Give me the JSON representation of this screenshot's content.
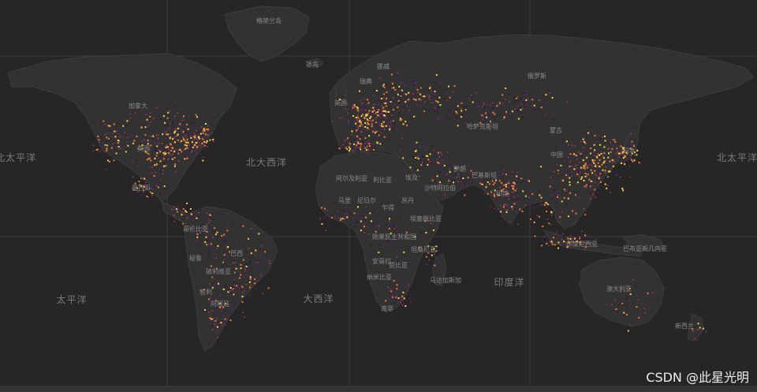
{
  "watermark": "CSDN @此星光明",
  "map": {
    "basemap": "dark-gray",
    "colors": {
      "background": "#262626",
      "land": "#323232",
      "land_edge": "#3d3d3d",
      "graticule": "#3a3d45",
      "point_palette": [
        "#2a0a4a",
        "#5a1f72",
        "#8d2b6e",
        "#c1435a",
        "#ee7a3a",
        "#fbd44c"
      ]
    },
    "ocean_labels": [
      "北太平洋",
      "北大西洋",
      "太平洋",
      "大西洋",
      "印度洋"
    ],
    "place_labels": [
      "格陵兰岛",
      "冰岛",
      "挪威",
      "瑞典",
      "俄罗斯",
      "加拿大",
      "美国",
      "墨西哥",
      "英国",
      "哈萨克斯坦",
      "蒙古",
      "中国",
      "日本",
      "阿尔及利亚",
      "利比亚",
      "埃及",
      "沙特阿拉伯",
      "伊朗",
      "巴基斯坦",
      "印度",
      "马里",
      "尼日尔",
      "乍得",
      "苏丹",
      "埃塞俄比亚",
      "哥伦比亚",
      "秘鲁",
      "巴西",
      "玻利维亚",
      "智利",
      "阿根廷",
      "刚果民主共和国",
      "安哥拉",
      "坦桑尼亚",
      "赞比亚",
      "纳米比亚",
      "南非",
      "马达加斯加",
      "印度尼西亚",
      "巴布亚新几内亚",
      "澳大利亚",
      "新西兰"
    ]
  }
}
